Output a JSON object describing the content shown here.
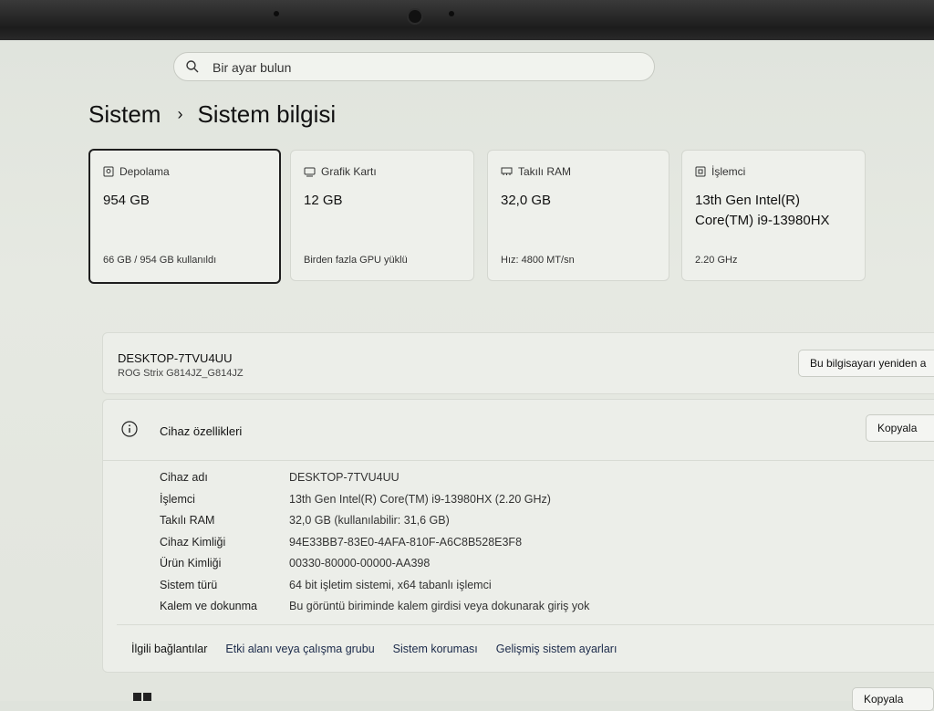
{
  "search": {
    "placeholder": "Bir ayar bulun"
  },
  "breadcrumb": {
    "parent": "Sistem",
    "current": "Sistem bilgisi"
  },
  "cards": [
    {
      "title": "Depolama",
      "value": "954 GB",
      "sub": "66 GB / 954 GB kullanıldı",
      "icon": "storage-icon"
    },
    {
      "title": "Grafik Kartı",
      "value": "12 GB",
      "sub": "Birden fazla GPU yüklü",
      "icon": "gpu-icon"
    },
    {
      "title": "Takılı RAM",
      "value": "32,0 GB",
      "sub": "Hız: 4800 MT/sn",
      "icon": "ram-icon"
    },
    {
      "title": "İşlemci",
      "value": "13th Gen Intel(R) Core(TM) i9-13980HX",
      "sub": "2.20 GHz",
      "icon": "cpu-icon"
    }
  ],
  "device": {
    "name": "DESKTOP-7TVU4UU",
    "model": "ROG Strix G814JZ_G814JZ",
    "rename_label": "Bu bilgisayarı yeniden a"
  },
  "specs": {
    "title": "Cihaz özellikleri",
    "copy_label": "Kopyala",
    "rows": [
      {
        "k": "Cihaz adı",
        "v": "DESKTOP-7TVU4UU"
      },
      {
        "k": "İşlemci",
        "v": "13th Gen Intel(R) Core(TM) i9-13980HX (2.20 GHz)"
      },
      {
        "k": "Takılı RAM",
        "v": "32,0 GB (kullanılabilir: 31,6 GB)"
      },
      {
        "k": "Cihaz Kimliği",
        "v": "94E33BB7-83E0-4AFA-810F-A6C8B528E3F8"
      },
      {
        "k": "Ürün Kimliği",
        "v": "00330-80000-00000-AA398"
      },
      {
        "k": "Sistem türü",
        "v": "64 bit işletim sistemi, x64 tabanlı işlemci"
      },
      {
        "k": "Kalem ve dokunma",
        "v": "Bu görüntü biriminde kalem girdisi veya dokunarak giriş yok"
      }
    ]
  },
  "related": {
    "label": "İlgili bağlantılar",
    "links": [
      "Etki alanı veya çalışma grubu",
      "Sistem koruması",
      "Gelişmiş sistem ayarları"
    ]
  },
  "bottom": {
    "copy_label": "Kopyala"
  }
}
